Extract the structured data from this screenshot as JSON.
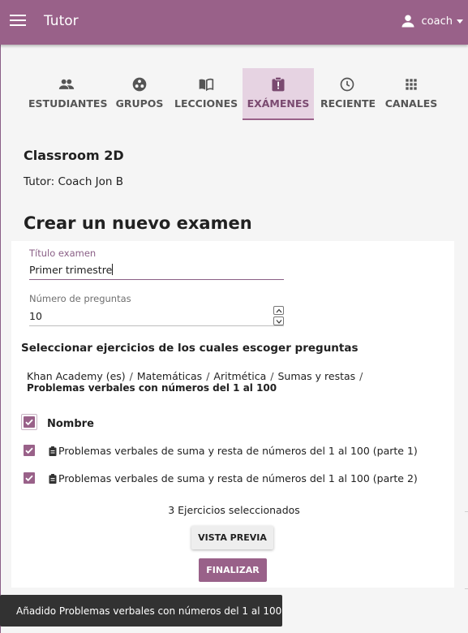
{
  "app": {
    "title": "Tutor",
    "user": "coach"
  },
  "nav": {
    "tabs": [
      {
        "label": "ESTUDIANTES",
        "icon": "people-icon"
      },
      {
        "label": "GRUPOS",
        "icon": "groups-icon"
      },
      {
        "label": "LECCIONES",
        "icon": "book-icon"
      },
      {
        "label": "EXÁMENES",
        "icon": "exam-icon",
        "active": true
      },
      {
        "label": "RECIENTE",
        "icon": "clock-icon"
      },
      {
        "label": "CANALES",
        "icon": "grid-icon"
      }
    ]
  },
  "classroom": {
    "name": "Classroom 2D",
    "coach_line": "Tutor: Coach Jon B"
  },
  "page": {
    "title": "Crear un nuevo examen"
  },
  "form": {
    "title_label": "Título examen",
    "title_value": "Primer trimestre",
    "questions_label": "Número de preguntas",
    "questions_value": "10"
  },
  "selection": {
    "heading": "Seleccionar ejercicios de los cuales escoger preguntas",
    "breadcrumbs": [
      "Khan Academy (es)",
      "Matemáticas",
      "Aritmética",
      "Sumas y restas"
    ],
    "current": "Problemas verbales con números del 1 al 100",
    "column_header": "Nombre",
    "rows": [
      {
        "title": "Problemas verbales de suma y resta de números del 1 al 100 (parte 1)",
        "checked": true
      },
      {
        "title": "Problemas verbales de suma y resta de números del 1 al 100 (parte 2)",
        "checked": true
      }
    ],
    "selected_count": "3 Ejercicios seleccionados"
  },
  "actions": {
    "preview": "VISTA PREVIA",
    "finish": "FINALIZAR"
  },
  "snackbar": {
    "message": "Añadido Problemas verbales con números del 1 al 100"
  },
  "colors": {
    "brand": "#996189",
    "active_tab_bg": "#e6d3e2",
    "snackbar": "#323232"
  }
}
